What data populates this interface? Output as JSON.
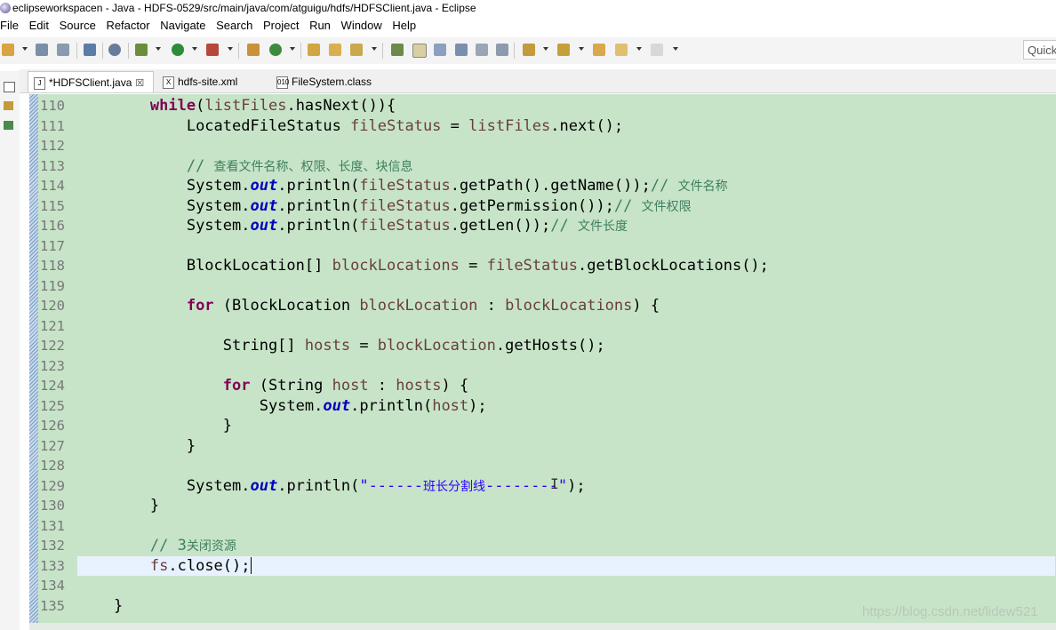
{
  "window": {
    "title": "eclipseworkspacen - Java - HDFS-0529/src/main/java/com/atguigu/hdfs/HDFSClient.java - Eclipse"
  },
  "menu": [
    "File",
    "Edit",
    "Source",
    "Refactor",
    "Navigate",
    "Search",
    "Project",
    "Run",
    "Window",
    "Help"
  ],
  "quick_access": {
    "label": "Quick"
  },
  "tabs": [
    {
      "label": "*HDFSClient.java",
      "icon": "java-file-icon",
      "close": "☒",
      "active": true
    },
    {
      "label": "hdfs-site.xml",
      "icon": "xml-file-icon",
      "active": false
    },
    {
      "label": "FileSystem.class",
      "icon": "class-file-icon",
      "active": false
    }
  ],
  "editor": {
    "line_numbers": [
      "110",
      "111",
      "112",
      "113",
      "114",
      "115",
      "116",
      "117",
      "118",
      "119",
      "120",
      "121",
      "122",
      "123",
      "124",
      "125",
      "126",
      "127",
      "128",
      "129",
      "130",
      "131",
      "132",
      "133",
      "134",
      "135"
    ],
    "current_line": "133",
    "background": "#c7e4c8",
    "code": {
      "l110": {
        "kw": "while",
        "a": "(",
        "v": "listFiles",
        "b": ".hasNext()){"
      },
      "l111": {
        "a": "LocatedFileStatus ",
        "v": "fileStatus",
        "b": " = ",
        "v2": "listFiles",
        "c": ".next();"
      },
      "l113": {
        "cm": "// ",
        "cjk": "查看文件名称、权限、长度、块信息"
      },
      "l114": {
        "a": "System.",
        "st": "out",
        "b": ".println(",
        "v": "fileStatus",
        "c": ".getPath().getName());",
        "cm": "// ",
        "cjk": "文件名称"
      },
      "l115": {
        "a": "System.",
        "st": "out",
        "b": ".println(",
        "v": "fileStatus",
        "c": ".getPermission());",
        "cm": "// ",
        "cjk": "文件权限"
      },
      "l116": {
        "a": "System.",
        "st": "out",
        "b": ".println(",
        "v": "fileStatus",
        "c": ".getLen());",
        "cm": "// ",
        "cjk": "文件长度"
      },
      "l118": {
        "a": "BlockLocation[] ",
        "v": "blockLocations",
        "b": " = ",
        "v2": "fileStatus",
        "c": ".getBlockLocations();"
      },
      "l120": {
        "kw": "for",
        "a": " (BlockLocation ",
        "v": "blockLocation",
        "b": " : ",
        "v2": "blockLocations",
        "c": ") {"
      },
      "l122": {
        "a": "String[] ",
        "v": "hosts",
        "b": " = ",
        "v2": "blockLocation",
        "c": ".getHosts();"
      },
      "l124": {
        "kw": "for",
        "a": " (String ",
        "v": "host",
        "b": " : ",
        "v2": "hosts",
        "c": ") {"
      },
      "l125": {
        "a": "System.",
        "st": "out",
        "b": ".println(",
        "v": "host",
        "c": ");"
      },
      "l126": {
        "a": "}"
      },
      "l127": {
        "a": "}"
      },
      "l129": {
        "a": "System.",
        "st": "out",
        "b": ".println(",
        "s1": "\"------",
        "cjk": "班长分割线",
        "s2": "--------\"",
        "c": ");"
      },
      "l130": {
        "a": "}"
      },
      "l132": {
        "cm": "// 3",
        "cjk": "关闭资源"
      },
      "l133": {
        "v": "fs",
        "a": ".close();"
      },
      "l135": {
        "a": "}"
      }
    }
  },
  "watermark": "https://blog.csdn.net/lidew521"
}
